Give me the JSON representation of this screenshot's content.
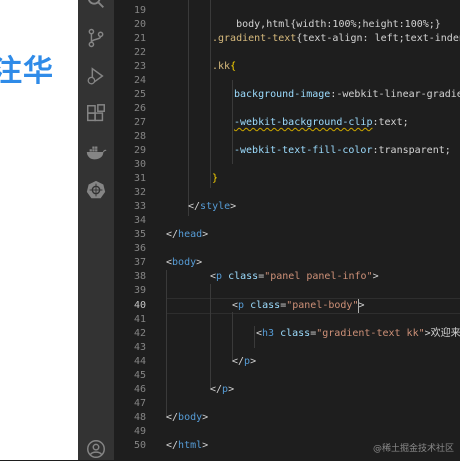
{
  "left_panel": {
    "text": "注华"
  },
  "activity_bar": {
    "icons": [
      "search-icon",
      "source-control-icon",
      "run-debug-icon",
      "extensions-icon",
      "docker-icon",
      "kubernetes-icon",
      "account-icon"
    ]
  },
  "editor": {
    "line_numbers": [
      "19",
      "20",
      "21",
      "22",
      "23",
      "24",
      "25",
      "26",
      "27",
      "28",
      "29",
      "30",
      "31",
      "32",
      "33",
      "34",
      "35",
      "36",
      "37",
      "38",
      "39",
      "40",
      "41",
      "42",
      "43",
      "44",
      "45",
      "46",
      "47",
      "48",
      "49",
      "50"
    ],
    "active_line": "40",
    "lines": {
      "l19": "body,html{width:100%;height:100%;}",
      "l21_sel": ".gradient-text",
      "l21_rest": "{text-align: left;text-indent:",
      "l23_sel": ".kk",
      "l23_brace": "{",
      "l25_prop": "background-image",
      "l25_val": ":-webkit-linear-gradient",
      "l27_prop": "-webkit-background-clip",
      "l27_val": ":text;",
      "l29_prop": "-webkit-text-fill-color",
      "l29_val": ":transparent;",
      "l31": "}",
      "l33_open": "</",
      "l33_tag": "style",
      "l33_close": ">",
      "l35_open": "</",
      "l35_tag": "head",
      "l35_close": ">",
      "l37_open": "<",
      "l37_tag": "body",
      "l37_close": ">",
      "l38_open": "<",
      "l38_tag": "p",
      "l38_attr": " class",
      "l38_eq": "=",
      "l38_str": "\"panel panel-info\"",
      "l38_close": ">",
      "l40_open": "<",
      "l40_tag": "p",
      "l40_attr": " class",
      "l40_eq": "=",
      "l40_str": "\"panel-body\"",
      "l40_close": ">",
      "l42_open": "<",
      "l42_tag": "h3",
      "l42_attr": " class",
      "l42_eq": "=",
      "l42_str": "\"gradient-text kk\"",
      "l42_close": ">",
      "l42_text": "欢迎来到龙",
      "l44_open": "</",
      "l44_tag": "p",
      "l44_close": ">",
      "l46_open": "</",
      "l46_tag": "p",
      "l46_close": ">",
      "l48_open": "</",
      "l48_tag": "body",
      "l48_close": ">",
      "l50_open": "</",
      "l50_tag": "html",
      "l50_close": ">"
    }
  },
  "watermark": "@稀土掘金技术社区"
}
